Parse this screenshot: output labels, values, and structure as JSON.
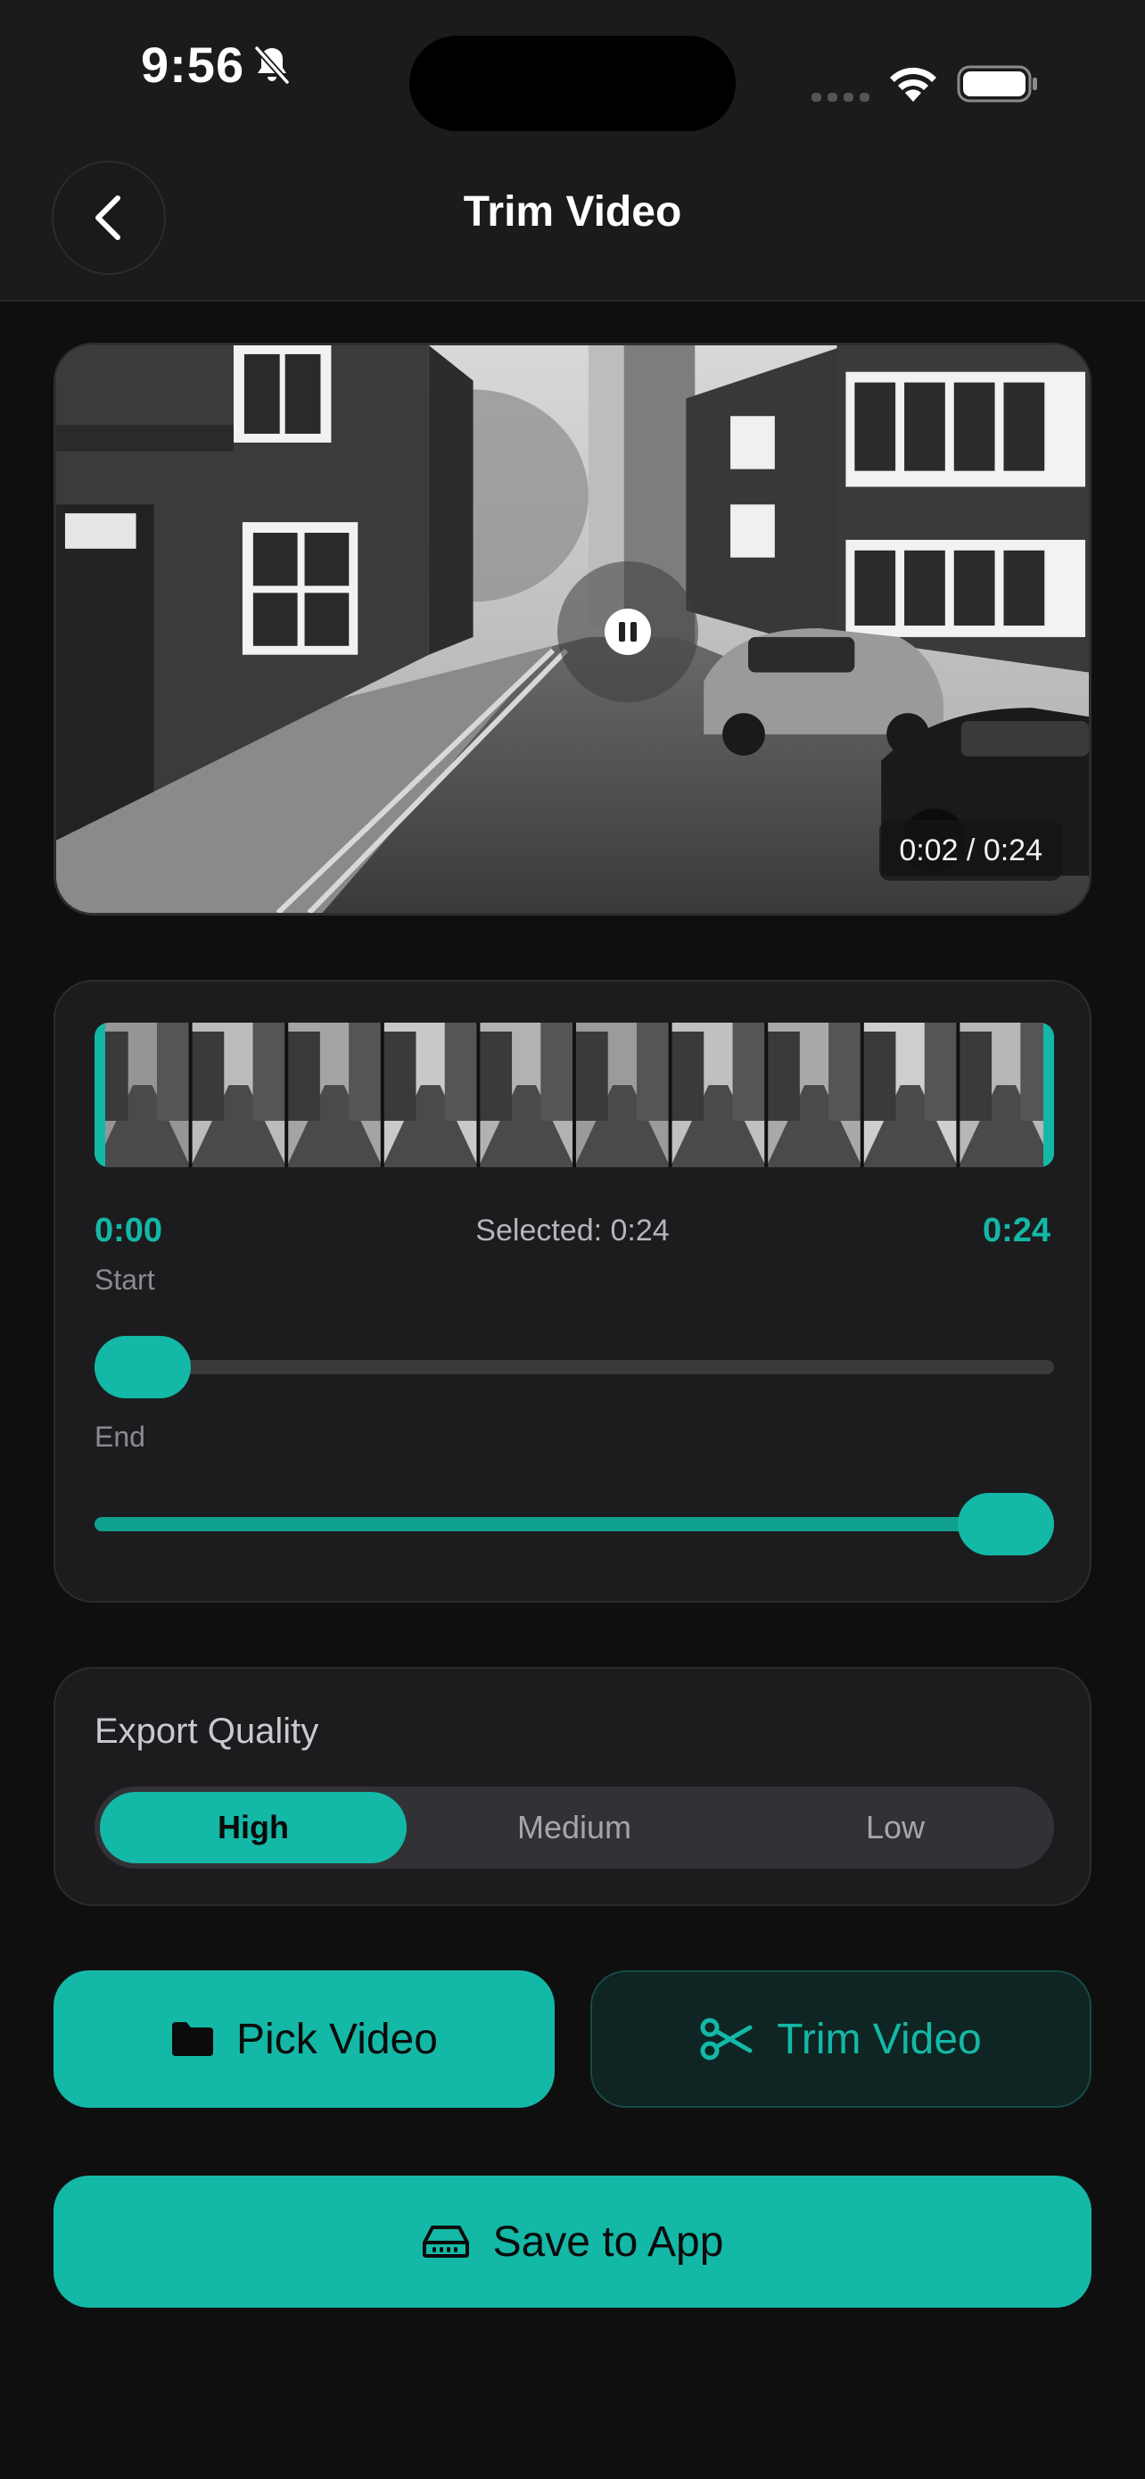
{
  "status_bar": {
    "time": "9:56"
  },
  "header": {
    "title": "Trim Video"
  },
  "player": {
    "time_display": "0:02 / 0:24",
    "state": "playing"
  },
  "trim": {
    "start_time": "0:00",
    "end_time": "0:24",
    "selected_label": "Selected: 0:24",
    "start_label": "Start",
    "end_label": "End",
    "start_fraction": 0,
    "end_fraction": 1
  },
  "quality": {
    "title": "Export Quality",
    "options": [
      "High",
      "Medium",
      "Low"
    ],
    "selected": "High"
  },
  "actions": {
    "pick_label": "Pick Video",
    "trim_label": "Trim Video",
    "save_label": "Save to App"
  },
  "colors": {
    "accent": "#14b8a6",
    "background": "#0f0f10",
    "card": "#1c1c1e"
  }
}
